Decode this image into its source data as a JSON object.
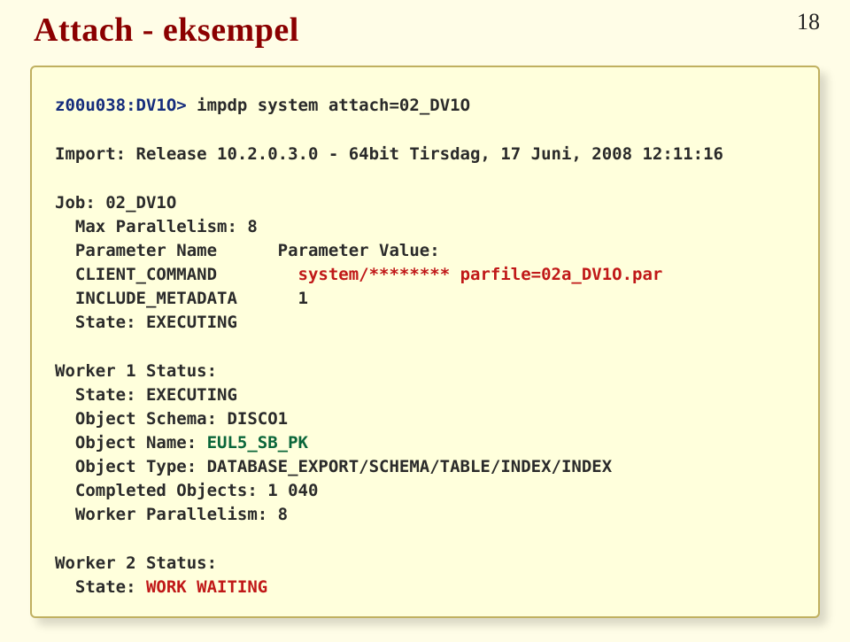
{
  "header": {
    "title": "Attach - eksempel",
    "page_number": "18"
  },
  "panel": {
    "command_line": {
      "prompt": "z00u038:DV1O> ",
      "command": "impdp system attach=02_DV1O"
    },
    "release_line": "Import: Release 10.2.0.3.0 - 64bit Tirsdag, 17 Juni, 2008 12:11:16",
    "job": {
      "label": "Job: 02_DV1O",
      "parallel": "  Max Parallelism: 8",
      "header": "  Parameter Name      Parameter Value:",
      "row1_name": "  CLIENT_COMMAND        ",
      "row1_value": "system/******** parfile=02a_DV1O.par",
      "row2": "  INCLUDE_METADATA      1",
      "state": "  State: EXECUTING"
    },
    "worker1": {
      "title": "Worker 1 Status:",
      "state": "  State: EXECUTING",
      "schema": "  Object Schema: DISCO1",
      "name_label": "  Object Name: ",
      "name_value": "EUL5_SB_PK",
      "type": "  Object Type: DATABASE_EXPORT/SCHEMA/TABLE/INDEX/INDEX",
      "completed": "  Completed Objects: 1 040",
      "parallel": "  Worker Parallelism: 8"
    },
    "worker2": {
      "title": "Worker 2 Status:",
      "state_label": "  State: ",
      "state_value": "WORK WAITING"
    }
  }
}
